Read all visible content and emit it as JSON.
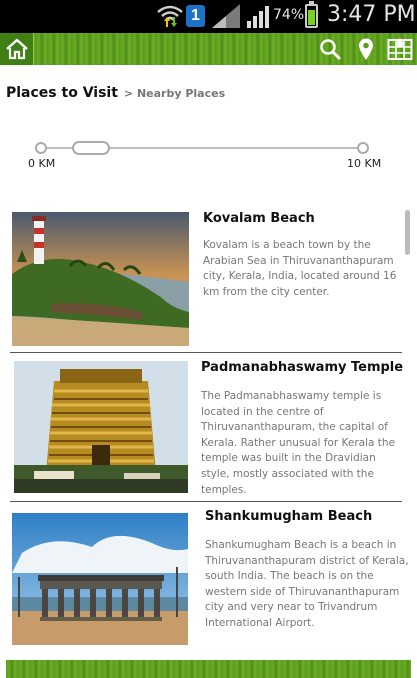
{
  "status_bar": {
    "notification_badge": "1",
    "battery": "74%",
    "time": "3:47 PM"
  },
  "header": {
    "icons": [
      "home-icon",
      "search-icon",
      "map-pin-icon",
      "map-grid-icon"
    ]
  },
  "page": {
    "title": "Places to Visit",
    "breadcrumb": "> Nearby Places"
  },
  "distance_slider": {
    "min_label": "0 KM",
    "max_label": "10 KM"
  },
  "places": [
    {
      "name": "Kovalam Beach",
      "description": "Kovalam is a beach town by the Arabian Sea in Thiruvananthapuram city, Kerala, India, located around 16 km from the city center."
    },
    {
      "name": "Padmanabhaswamy Temple",
      "description": "The Padmanabhaswamy temple is located in the centre of Thiruvananthapuram, the capital of Kerala. Rather unusual for Kerala the temple was built in the Dravidian style, mostly associated with the temples."
    },
    {
      "name": "Shankumugham Beach",
      "description": "Shankumugham Beach is a beach in Thiruvananthapuram district of Kerala, south India. The beach is on the western side of Thiruvananthapuram city and very near to Trivandrum International Airport."
    }
  ]
}
